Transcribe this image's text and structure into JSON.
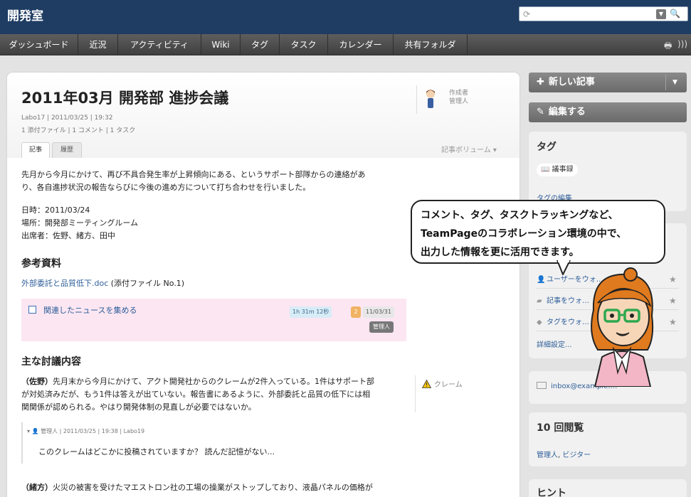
{
  "app": {
    "title": "開発室"
  },
  "search": {
    "value": "",
    "placeholder": ""
  },
  "nav": {
    "items": [
      "ダッシュボード",
      "近況",
      "アクティビティ",
      "Wiki",
      "タグ",
      "タスク",
      "カレンダー",
      "共有フォルダ"
    ],
    "print_icon": "print-icon",
    "feed_icon": "rss-icon"
  },
  "article": {
    "title": "2011年03月 開発部 進捗会議",
    "meta_line1": "Labo17 | 2011/03/25 | 19:32",
    "meta_line2": "1 添付ファイル | 1 コメント | 1 タスク",
    "author_role": "作成者",
    "author_name": "管理人",
    "tabs": [
      "記事",
      "履歴"
    ],
    "volume_label": "記事ボリューム ▾",
    "intro_line1": "先月から今月にかけて、再び不具合発生率が上昇傾向にある、というサポート部隊からの連絡があ",
    "intro_line2": "り、各自進捗状況の報告ならびに今後の進め方について打ち合わせを行いました。",
    "date_line": "日時：2011/03/24",
    "place_line": "場所：開発部ミーティングルーム",
    "attendees_line": "出席者：佐野、緒方、田中",
    "references_heading": "参考資料",
    "attachment_link": "外部委託と品質低下.doc",
    "attachment_note": " (添付ファイル No.1)",
    "task": {
      "label": "関連したニュースを集める",
      "time": "1h 31m 12秒",
      "count": "2",
      "date": "11/03/31",
      "owner": "管理人"
    },
    "discussion_heading": "主な討議内容",
    "speaker1": "（佐野）",
    "para1_line1": "先月末から今月にかけて、アクト開発社からのクレームが2件入っている。1件はサポート部",
    "para1_line2": "が対処済みだが、もう1件は答えが出ていない。報告書にあるように、外部委託と品質の低下には相",
    "para1_line3": "関関係が認められる。やはり開発体制の見直しが必要ではないか。",
    "claim_tag": "クレーム",
    "comment": {
      "meta": "管理人 | 2011/03/25 | 19:38 | Labo19",
      "text": "このクレームはどこかに投稿されていますか？ 読んだ記憶がない..."
    },
    "speaker2": "（緒方）",
    "para2": "火災の被害を受けたマエストロン社の工場の操業がストップしており、液晶パネルの価格が"
  },
  "sidebar": {
    "new_post": "新しい記事",
    "edit": "編集する",
    "tags_heading": "タグ",
    "tag_chip": "議事録",
    "tag_edit": "タグの編集",
    "watch_items": [
      "ユーザーをウォ…",
      "記事をウォ…",
      "タグをウォ…"
    ],
    "detail_settings": "詳細設定...",
    "inbox": "inbox@example.…",
    "views_heading": "10 回閲覧",
    "viewer1": "管理人",
    "viewer_sep": ",",
    "viewer2": "ビジター",
    "hint_heading": "ヒント"
  },
  "callout": {
    "line1": "コメント、タグ、タスクトラッキングなど、",
    "line2": "TeamPageのコラボレーション環境の中で、",
    "line3": "出力した情報を更に活用できます。"
  }
}
